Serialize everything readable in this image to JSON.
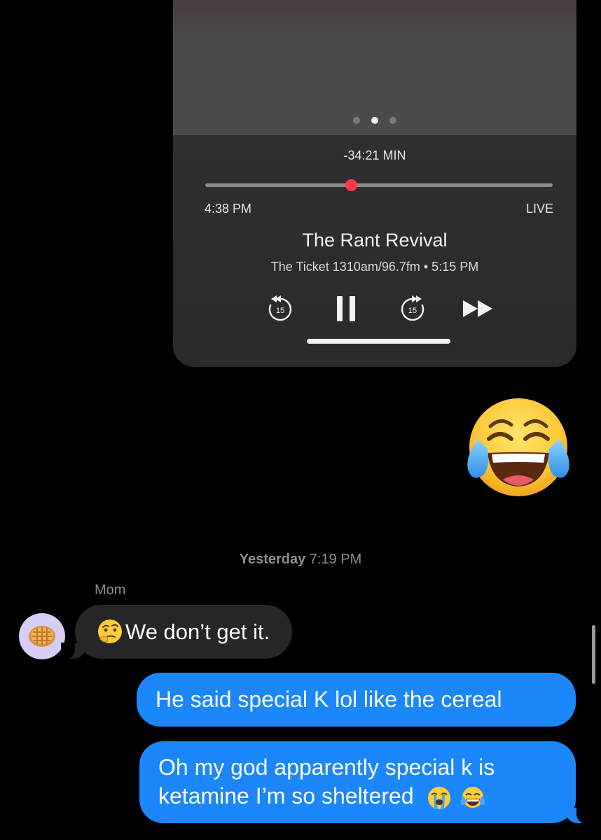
{
  "media_player": {
    "remaining": "-34:21 MIN",
    "progress": 0.42,
    "start_time": "4:38 PM",
    "live_label": "LIVE",
    "title": "The Rant Revival",
    "subtitle": "The Ticket 1310am/96.7fm • 5:15 PM",
    "skip_back_seconds": "15",
    "skip_forward_seconds": "15",
    "page_dots": {
      "count": 3,
      "active_index": 1
    },
    "accent_color": "#ff3b46"
  },
  "standalone_emoji": "face-with-tears-of-joy-icon",
  "timestamp": {
    "day": "Yesterday",
    "time": "7:19 PM"
  },
  "incoming": {
    "sender": "Mom",
    "avatar_icon": "waffle-icon",
    "leading_emoji": "thinking-face-icon",
    "text": "We don’t get it."
  },
  "outgoing": [
    {
      "text": "He said special K lol like the cereal"
    },
    {
      "line1": "Oh my god apparently special k is",
      "line2": "ketamine I’m so sheltered",
      "trailing_emojis": [
        "loudly-crying-face-icon",
        "face-with-tears-of-joy-icon"
      ]
    }
  ],
  "colors": {
    "outgoing_bubble": "#1b87fb",
    "incoming_bubble": "#262628",
    "timestamp_text": "#8e8e93"
  }
}
